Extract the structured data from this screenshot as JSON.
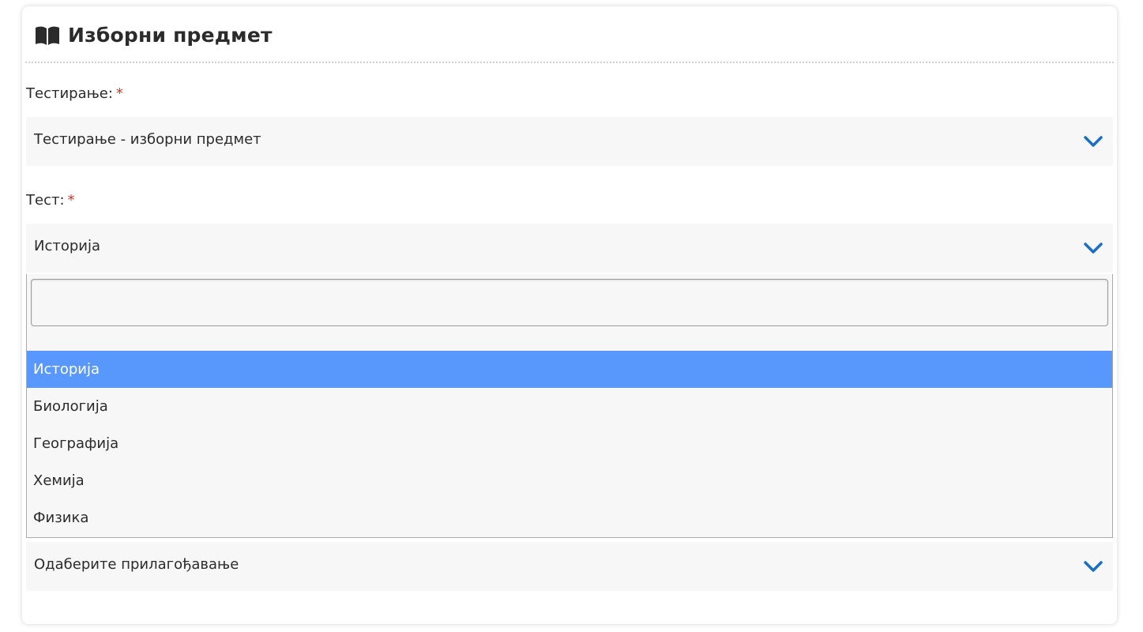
{
  "card": {
    "title": "Изборни предмет",
    "icon": "open-book-icon"
  },
  "fields": {
    "testing": {
      "label": "Тестирање:",
      "required_mark": "*",
      "value": "Тестирање - изборни предмет"
    },
    "test": {
      "label": "Тест:",
      "required_mark": "*",
      "value": "Историја",
      "open": true,
      "search_value": "",
      "options": [
        {
          "label": "Историја",
          "highlighted": true
        },
        {
          "label": "Биологија",
          "highlighted": false
        },
        {
          "label": "Географија",
          "highlighted": false
        },
        {
          "label": "Хемија",
          "highlighted": false
        },
        {
          "label": "Физика",
          "highlighted": false
        }
      ]
    },
    "adjustment": {
      "value": "Одаберите прилагођавање"
    }
  },
  "colors": {
    "accent": "#1a6fc4",
    "highlight": "#5897fb",
    "required": "#c0392b",
    "field_bg": "#f7f7f7"
  }
}
